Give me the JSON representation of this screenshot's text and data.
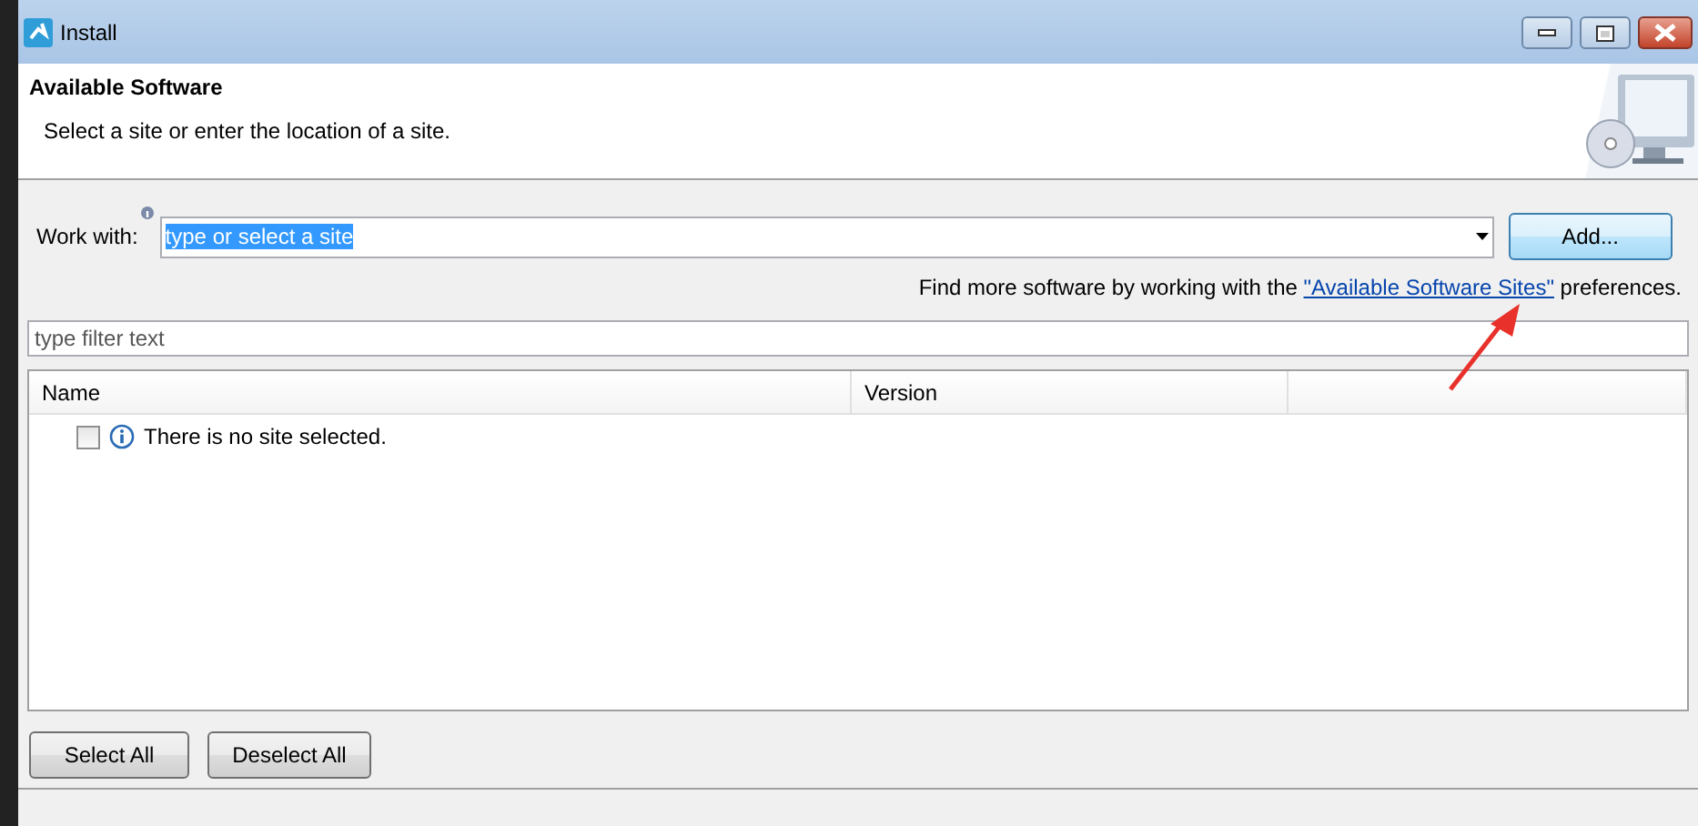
{
  "window": {
    "title": "Install"
  },
  "header": {
    "title": "Available Software",
    "description": "Select a site or enter the location of a site."
  },
  "work_with": {
    "label": "Work with:",
    "value": "type or select a site",
    "text_selected": true
  },
  "add_button": "Add...",
  "hint": {
    "before": "Find more software by working with the ",
    "link": "\"Available Software Sites\"",
    "after": " preferences."
  },
  "filter": {
    "placeholder": "type filter text"
  },
  "table": {
    "columns": [
      "Name",
      "Version"
    ],
    "rows": [
      {
        "kind": "info",
        "checked": false,
        "text": "There is no site selected."
      }
    ]
  },
  "buttons": [
    "Select All",
    "Deselect All"
  ]
}
